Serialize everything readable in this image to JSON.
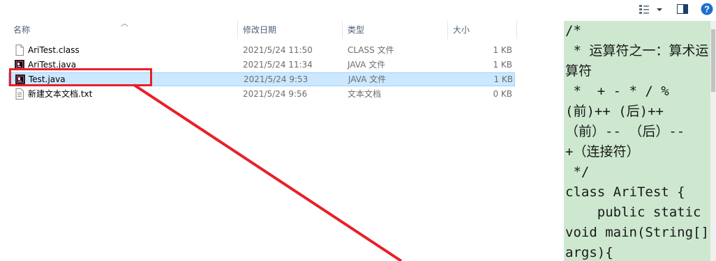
{
  "toolbar": {
    "view_menu_icon": "view-options-icon",
    "preview_pane_icon": "preview-pane-icon",
    "help_icon": "help-icon",
    "help_label": "?"
  },
  "columns": {
    "name": "名称",
    "date": "修改日期",
    "type": "类型",
    "size": "大小"
  },
  "files": [
    {
      "name": "AriTest.class",
      "date": "2021/5/24 11:50",
      "type": "CLASS 文件",
      "size": "1 KB",
      "icon": "class-file-icon",
      "selected": false
    },
    {
      "name": "AriTest.java",
      "date": "2021/5/24 11:34",
      "type": "JAVA 文件",
      "size": "1 KB",
      "icon": "java-file-icon",
      "selected": false
    },
    {
      "name": "Test.java",
      "date": "2021/5/24 9:53",
      "type": "JAVA 文件",
      "size": "1 KB",
      "icon": "java-file-icon",
      "selected": true
    },
    {
      "name": "新建文本文档.txt",
      "date": "2021/5/24 9:56",
      "type": "文本文档",
      "size": "0 KB",
      "icon": "text-file-icon",
      "selected": false
    }
  ],
  "preview": {
    "code": "/*\n * 运算符之一：算术运算符\n *  + - * / %\n(前)++ (后)++\n（前）-- （后）--\n+（连接符）\n */\nclass AriTest {\n    public static void main(String[] args){"
  },
  "colors": {
    "selection": "#cce8ff",
    "preview_bg": "#cde8cf",
    "annotation": "#e8202a",
    "help_blue": "#1d6fce"
  }
}
